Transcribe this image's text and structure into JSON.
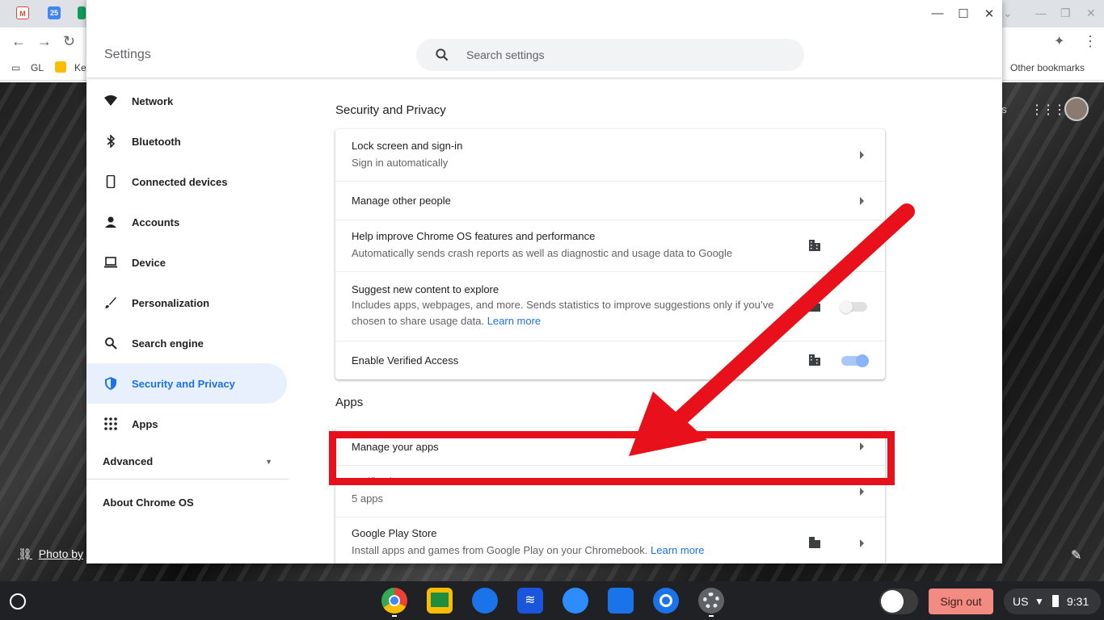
{
  "browser": {
    "tabs": [
      {
        "icon": "gmail-icon",
        "color": "#ea4335"
      },
      {
        "icon": "calendar-icon",
        "color": "#4285f4"
      },
      {
        "icon": "drive-icon",
        "color": "#0f9d58"
      }
    ],
    "bookmarks": [
      {
        "label": "GL",
        "icon": "folder-icon"
      },
      {
        "label": "Ke",
        "icon": "keep-icon"
      }
    ],
    "other_bookmarks": "Other bookmarks",
    "partial_text": "es"
  },
  "wallpaper": {
    "photo_credit": "Photo by"
  },
  "settings": {
    "title": "Settings",
    "search_placeholder": "Search settings",
    "nav": [
      {
        "label": "Network",
        "icon": "wifi-icon"
      },
      {
        "label": "Bluetooth",
        "icon": "bluetooth-icon"
      },
      {
        "label": "Connected devices",
        "icon": "phone-icon"
      },
      {
        "label": "Accounts",
        "icon": "person-icon"
      },
      {
        "label": "Device",
        "icon": "laptop-icon"
      },
      {
        "label": "Personalization",
        "icon": "brush-icon"
      },
      {
        "label": "Search engine",
        "icon": "search-icon"
      },
      {
        "label": "Security and Privacy",
        "icon": "shield-icon",
        "active": true
      },
      {
        "label": "Apps",
        "icon": "apps-grid-icon"
      }
    ],
    "advanced": "Advanced",
    "about": "About Chrome OS",
    "security_section": {
      "title": "Security and Privacy",
      "rows": [
        {
          "title": "Lock screen and sign-in",
          "subtitle": "Sign in automatically"
        },
        {
          "title": "Manage other people"
        },
        {
          "title": "Help improve Chrome OS features and performance",
          "subtitle": "Automatically sends crash reports as well as diagnostic and usage data to Google"
        },
        {
          "title": "Suggest new content to explore",
          "subtitle_line1": "Includes apps, webpages, and more. Sends statistics to improve suggestions only if you’ve",
          "subtitle_line2": "chosen to share usage data.",
          "link": "Learn more",
          "toggle": "off"
        },
        {
          "title": "Enable Verified Access",
          "toggle": "on"
        }
      ]
    },
    "apps_section": {
      "title": "Apps",
      "rows": [
        {
          "title": "Manage your apps"
        },
        {
          "title": "Notifications",
          "subtitle": "5 apps"
        },
        {
          "title": "Google Play Store",
          "subtitle": "Install apps and games from Google Play on your Chromebook.",
          "link": "Learn more"
        }
      ]
    }
  },
  "shelf": {
    "apps": [
      "chrome-icon",
      "classroom-icon",
      "security-app-icon",
      "stream-app-icon",
      "zoom-icon",
      "files-icon",
      "camera-icon",
      "settings-gear-icon"
    ],
    "sign_out": "Sign out",
    "locale": "US",
    "time": "9:31"
  },
  "colors": {
    "accent": "#1a73e8",
    "annotation_red": "#e8101a",
    "signout_bg": "#f28b82"
  }
}
